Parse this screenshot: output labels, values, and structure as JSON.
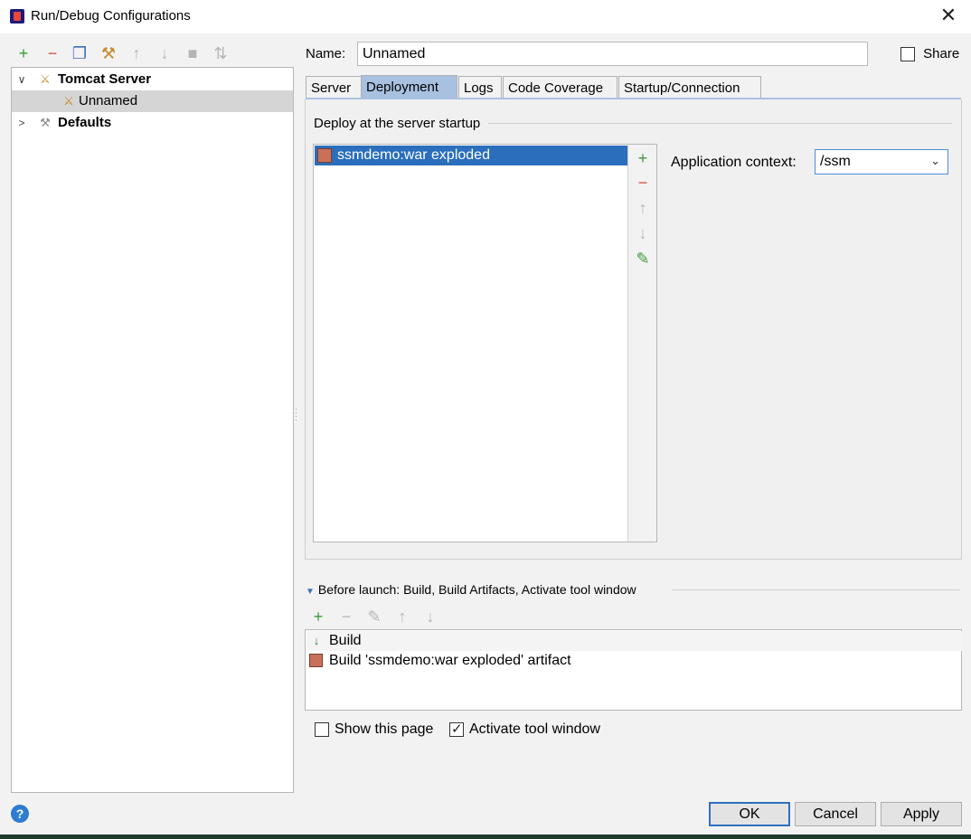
{
  "window": {
    "title": "Run/Debug Configurations",
    "close_glyph": "✕"
  },
  "left_toolbar": [
    {
      "name": "add-config-button",
      "glyph": "+",
      "color": "green"
    },
    {
      "name": "remove-config-button",
      "glyph": "−",
      "color": "red"
    },
    {
      "name": "copy-config-button",
      "glyph": "❐",
      "color": "blue"
    },
    {
      "name": "edit-defaults-button",
      "glyph": "⚒",
      "color": "gray"
    },
    {
      "name": "move-up-button",
      "glyph": "↑",
      "color": "gray"
    },
    {
      "name": "move-down-button",
      "glyph": "↓",
      "color": "gray"
    },
    {
      "name": "folder-button",
      "glyph": "■",
      "color": "gray"
    },
    {
      "name": "sort-button",
      "glyph": "⇅",
      "color": "gray"
    }
  ],
  "tree": {
    "tomcat_server": {
      "label": "Tomcat Server",
      "arrow": "∨",
      "icon": "tomcat-icon"
    },
    "unnamed": {
      "label": "Unnamed",
      "icon": "tomcat-icon"
    },
    "defaults": {
      "label": "Defaults",
      "arrow": ">",
      "icon": "wrench-icon"
    }
  },
  "name_field": {
    "label": "Name:",
    "value": "Unnamed"
  },
  "share": {
    "label": "Share",
    "checked": false
  },
  "tabs": [
    {
      "label": "Server",
      "active": false
    },
    {
      "label": "Deployment",
      "active": true
    },
    {
      "label": "Logs",
      "active": false
    },
    {
      "label": "Code Coverage",
      "active": false
    },
    {
      "label": "Startup/Connection",
      "active": false
    }
  ],
  "deployment": {
    "section_title": "Deploy at the server startup",
    "items": [
      {
        "label": "ssmdemo:war exploded",
        "selected": true
      }
    ],
    "side_buttons": {
      "add": "+",
      "remove": "−",
      "up": "↑",
      "down": "↓",
      "edit": "✎"
    },
    "app_context_label": "Application context:",
    "app_context_value": "/ssm"
  },
  "before_launch": {
    "title": "Before launch: Build, Build Artifacts, Activate tool window",
    "toolbar": {
      "add": "+",
      "remove": "−",
      "edit": "✎",
      "up": "↑",
      "down": "↓"
    },
    "items": [
      {
        "label": "Build",
        "icon": "build-icon"
      },
      {
        "label": "Build 'ssmdemo:war exploded' artifact",
        "icon": "artifact-icon"
      }
    ]
  },
  "options": {
    "show_this_page": {
      "label": "Show this page",
      "checked": false
    },
    "activate_tool_window": {
      "label": "Activate tool window",
      "checked": true
    }
  },
  "buttons": {
    "ok": "OK",
    "cancel": "Cancel",
    "apply": "Apply",
    "help": "?"
  }
}
